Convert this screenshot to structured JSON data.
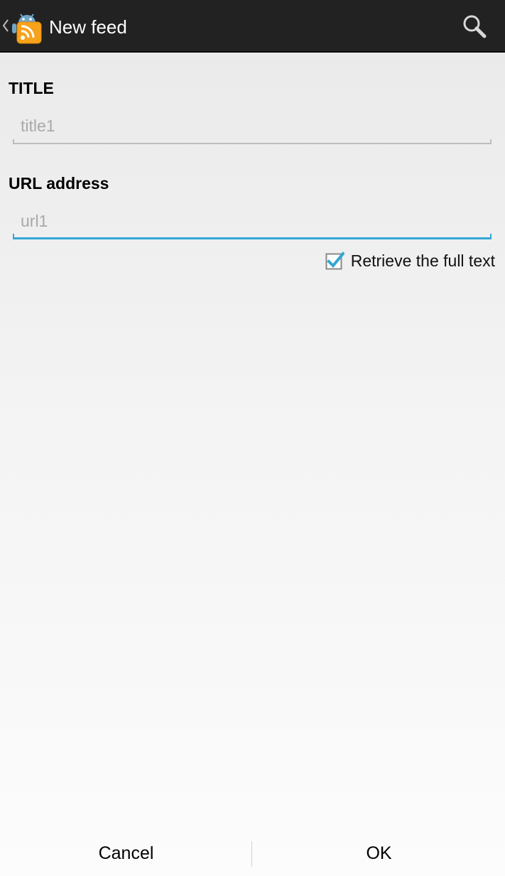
{
  "action_bar": {
    "title": "New feed",
    "app_icon": "android-rss-app-icon",
    "up_icon": "chevron-left-icon",
    "search_icon": "search-icon",
    "background_color": "#222222"
  },
  "form": {
    "title_label": "TITLE",
    "title_placeholder": "title1",
    "url_label": "URL address",
    "url_placeholder": "url1",
    "focus_color": "#33a7d5",
    "full_text_checkbox": {
      "label": "Retrieve the full text",
      "checked": true
    }
  },
  "buttons": {
    "cancel_label": "Cancel",
    "ok_label": "OK"
  }
}
